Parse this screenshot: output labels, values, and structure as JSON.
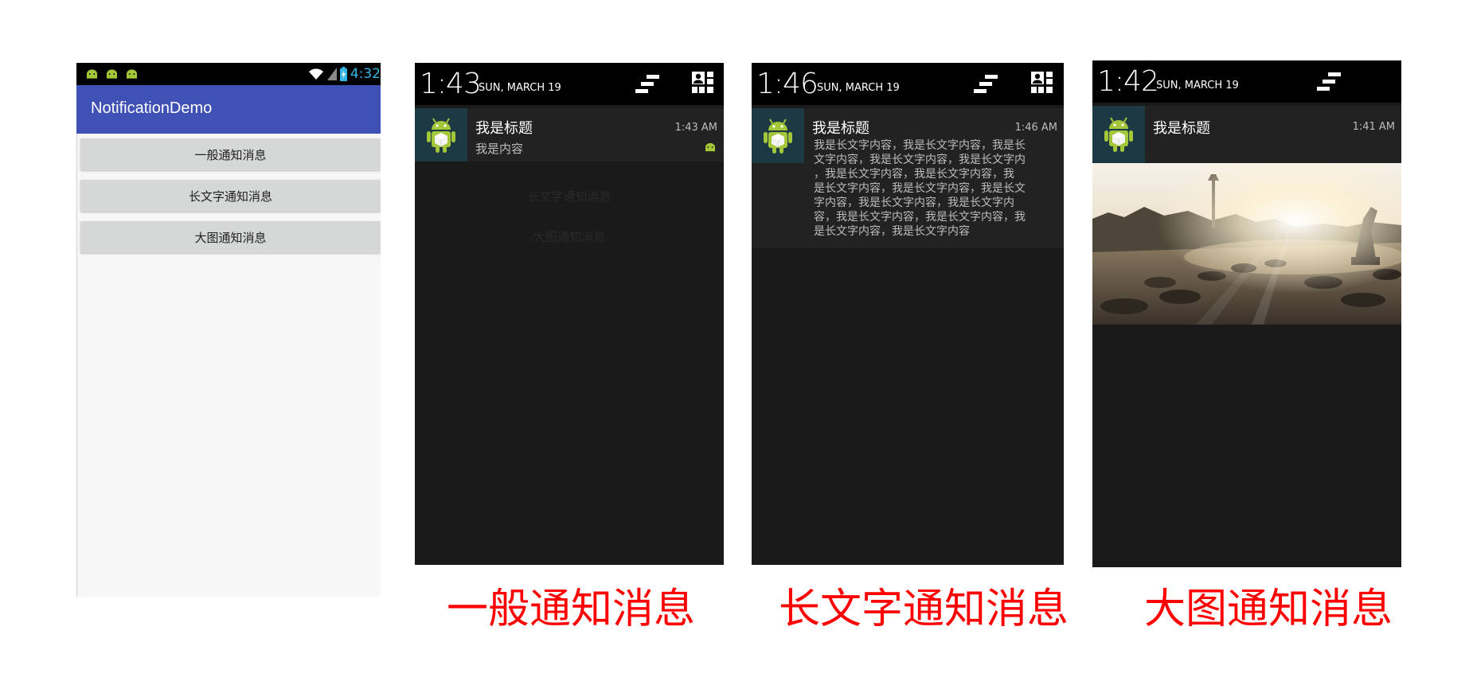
{
  "app": {
    "status_time": "4:32",
    "title": "NotificationDemo",
    "buttons": [
      "一般通知消息",
      "长文字通知消息",
      "大图通知消息"
    ]
  },
  "panels": [
    {
      "time": "1:43",
      "date": "SUN, MARCH 19",
      "notification": {
        "title": "我是标题",
        "text": "我是内容",
        "time": "1:43 AM"
      },
      "background_buttons": [
        "长文字通知消息",
        "大图通知消息"
      ],
      "caption": "一般通知消息"
    },
    {
      "time": "1:46",
      "date": "SUN, MARCH 19",
      "notification": {
        "title": "我是标题",
        "time": "1:46 AM",
        "text_lines": [
          "我是长文字内容，我是长文字内容，我是长",
          "文字内容，我是长文字内容，我是长文字内",
          "，我是长文字内容，我是长文字内容，我",
          "是长文字内容，我是长文字内容，我是长文",
          "字内容，我是长文字内容，我是长文字内",
          "容，我是长文字内容，我是长文字内容，我",
          "是长文字内容，我是长文字内容"
        ]
      },
      "caption": "长文字通知消息"
    },
    {
      "time": "1:42",
      "date": "SUN, MARCH 19",
      "notification": {
        "title": "我是标题",
        "time": "1:41 AM",
        "image": "sunset-fountain-photo"
      },
      "caption": "大图通知消息"
    }
  ],
  "colors": {
    "caption": "#ff0000",
    "app_bar": "#3f51b5",
    "status_clock": "#33b5e5",
    "android_green": "#a4c639"
  },
  "icons": [
    "android-icon",
    "wifi-icon",
    "signal-icon",
    "battery-icon",
    "clear-all-icon",
    "quick-settings-icon"
  ]
}
